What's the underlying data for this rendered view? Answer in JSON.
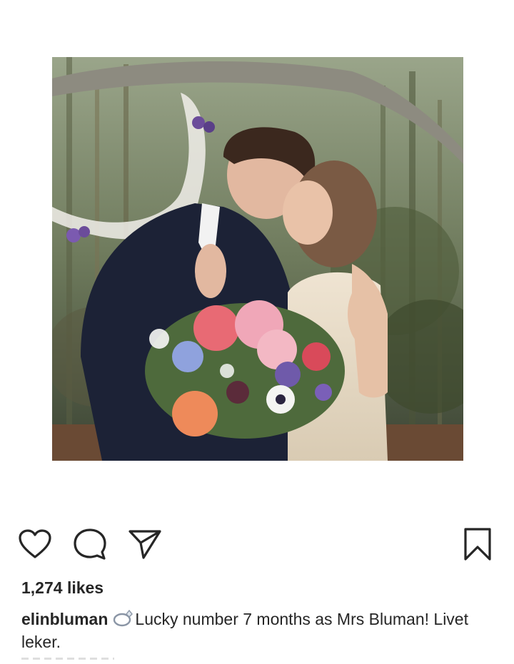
{
  "post": {
    "image_alt": "Wedding couple kissing under a tree holding a flower bouquet",
    "likes_text": "1,274 likes",
    "username": "elinbluman",
    "ring_icon": "ring-icon",
    "caption_text": "Lucky number 7 months as Mrs Bluman! Livet leker."
  },
  "actions": {
    "like_icon": "heart-icon",
    "comment_icon": "comment-bubble-icon",
    "share_icon": "paper-plane-icon",
    "save_icon": "bookmark-icon"
  },
  "colors": {
    "text": "#262626",
    "background": "#ffffff"
  }
}
